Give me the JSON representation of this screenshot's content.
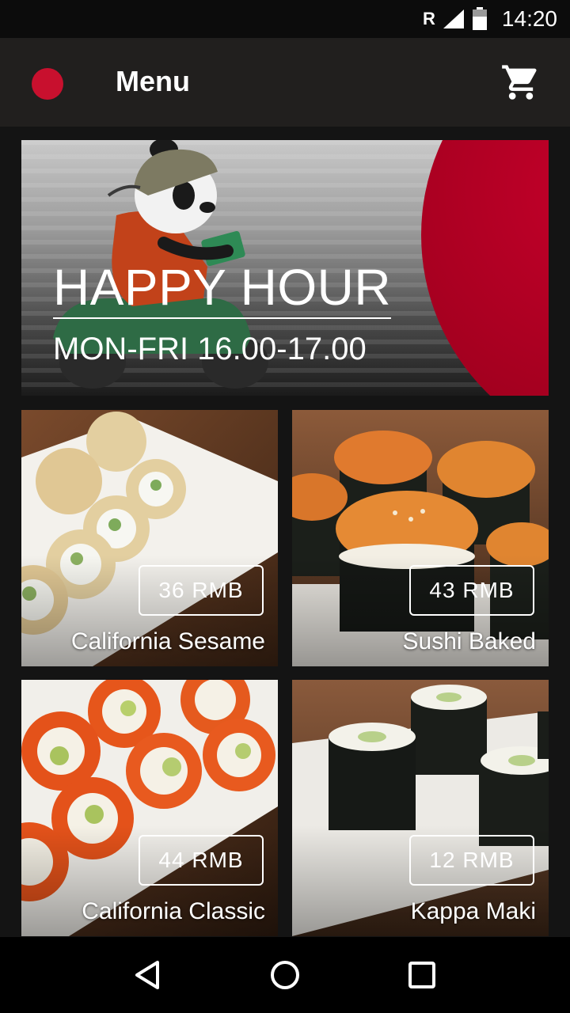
{
  "status_bar": {
    "network": "R",
    "time": "14:20"
  },
  "app_bar": {
    "title": "Menu"
  },
  "banner": {
    "title": "HAPPY HOUR",
    "subtitle": "MON-FRI 16.00-17.00"
  },
  "menu_items": [
    {
      "name": "California Sesame",
      "price": "36 RMB"
    },
    {
      "name": "Sushi Baked",
      "price": "43 RMB"
    },
    {
      "name": "California Classic",
      "price": "44 RMB"
    },
    {
      "name": "Kappa Maki",
      "price": "12 RMB"
    }
  ],
  "colors": {
    "accent": "#c8102e",
    "app_bar": "#211f1e",
    "background": "#141414"
  },
  "icons": {
    "cart": "shopping-cart-icon",
    "back": "back-triangle-icon",
    "home": "home-circle-icon",
    "recents": "recents-square-icon"
  }
}
